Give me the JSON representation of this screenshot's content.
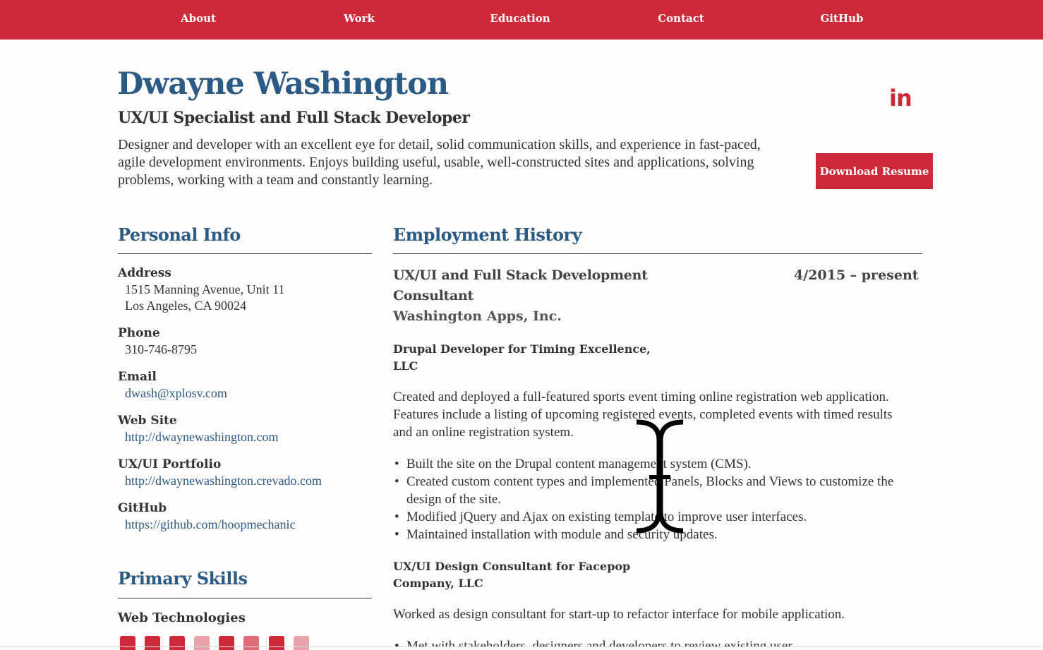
{
  "nav": {
    "items": [
      {
        "label": "About"
      },
      {
        "label": "Work"
      },
      {
        "label": "Education"
      },
      {
        "label": "Contact"
      },
      {
        "label": "GitHub"
      }
    ]
  },
  "header": {
    "name": "Dwayne Washington",
    "title": "UX/UI Specialist and Full Stack Developer",
    "summary": "Designer and developer with an excellent eye for detail, solid communication skills, and experience in fast-paced, agile development environments. Enjoys building useful, usable, well-constructed sites and applications, solving problems, working with a team and constantly learning.",
    "linkedin_label": "in",
    "download_label": "Download Resume"
  },
  "personal_info": {
    "heading": "Personal Info",
    "address_label": "Address",
    "address_line1": "1515 Manning Avenue, Unit 11",
    "address_line2": "Los Angeles, CA 90024",
    "phone_label": "Phone",
    "phone": "310-746-8795",
    "email_label": "Email",
    "email": "dwash@xplosv.com",
    "website_label": "Web Site",
    "website": "http://dwaynewashington.com",
    "portfolio_label": "UX/UI Portfolio",
    "portfolio": "http://dwaynewashington.crevado.com",
    "github_label": "GitHub",
    "github": "https://github.com/hoopmechanic"
  },
  "skills": {
    "heading": "Primary Skills",
    "web_tech_label": "Web Technologies",
    "icons": [
      "html5-icon",
      "css3-icon",
      "bootstrap-icon",
      "mobile-icon",
      "drupal-icon",
      "git-icon",
      "sass-icon",
      "xplus-icon"
    ]
  },
  "employment": {
    "heading": "Employment History",
    "job1": {
      "title": "UX/UI and Full Stack Development Consultant",
      "dates": "4/2015 – present",
      "company": "Washington Apps, Inc."
    },
    "project1": {
      "heading": "Drupal Developer for Timing Excellence, LLC",
      "description": "Created and deployed a full-featured sports event timing online registration web application. Features include a listing of upcoming registered events, completed events with timed results and an online registration system.",
      "bullets": [
        "Built the site on the Drupal content management system (CMS).",
        "Created custom content types and implemented Panels, Blocks and Views to customize the design of the site.",
        "Modified jQuery and Ajax on existing template to improve user interfaces.",
        "Maintained installation with module and security updates."
      ]
    },
    "project2": {
      "heading": "UX/UI Design Consultant for Facepop Company, LLC",
      "description": "Worked as design consultant for start-up to refactor interface for mobile application.",
      "bullet1": "Met with stakeholders, designers and developers to review existing user"
    }
  },
  "colors": {
    "accent": "#ce2939",
    "heading_blue": "#2a5a86",
    "background": "#fffdfb"
  }
}
